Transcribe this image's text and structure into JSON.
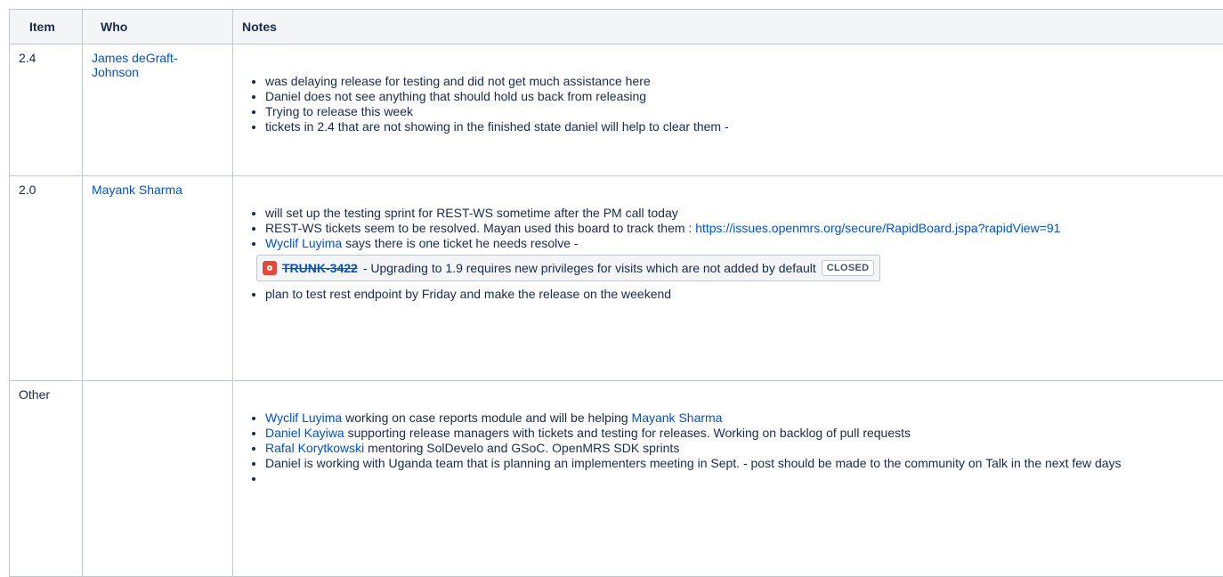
{
  "table": {
    "headers": {
      "item": "Item",
      "who": "Who",
      "notes": "Notes"
    }
  },
  "rows": [
    {
      "item": "2.4",
      "who": "James deGraft-Johnson",
      "notes": [
        "was delaying release for testing and did not get much assistance here",
        "Daniel does not see anything that should hold us back from releasing",
        "Trying to release this week",
        "tickets in 2.4 that are not showing in the finished state daniel will help to clear them -"
      ]
    },
    {
      "item": "2.0",
      "who": "Mayank Sharma",
      "notes": {
        "n1": "will set up the testing sprint for REST-WS sometime after the PM call today",
        "n2_text": "REST-WS tickets seem to be resolved. Mayan used this board to track them : ",
        "n2_link": "https://issues.openmrs.org/secure/RapidBoard.jspa?rapidView=91",
        "n3_mention": "Wyclif Luyima",
        "n3_text": " says there is one ticket he needs resolve -",
        "jira": {
          "key": "TRUNK-3422",
          "summary": " - Upgrading to 1.9 requires new privileges for visits which are not added by default ",
          "status": "CLOSED",
          "icon": "jira-bug-icon",
          "icon_color": "#e5493a"
        },
        "n4": "plan to test rest endpoint by Friday and make the release on the weekend"
      }
    },
    {
      "item": "Other",
      "who": "",
      "notes": {
        "o1_mention": "Wyclif Luyima",
        "o1_text": " working on case reports module and will be helping ",
        "o1_mention2": "Mayank Sharma",
        "o2_mention": "Daniel Kayiwa",
        "o2_text": " supporting release managers with tickets and testing for releases. Working on backlog of pull requests",
        "o3_mention": "Rafal Korytkowski",
        "o3_text": " mentoring SolDevelo and GSoC. OpenMRS SDK sprints",
        "o4": "Daniel is working with Uganda team that is planning an implementers meeting in Sept. - post should be made to the community on Talk in the next few days",
        "o5": ""
      }
    }
  ],
  "colors": {
    "link": "#0052cc",
    "header_bg": "#f4f5f7",
    "border": "#c1c7d0"
  }
}
